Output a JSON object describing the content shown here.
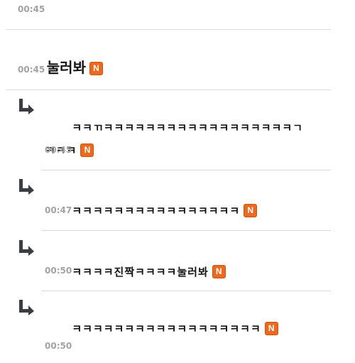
{
  "comments": [
    {
      "type": "time-only",
      "time": "00:45"
    },
    {
      "type": "post",
      "text": "눌러봐",
      "new_badge": "N",
      "time": "00:45"
    },
    {
      "type": "reply",
      "icon": "reply-arrow-icon",
      "text": "ㅋㅋㄲㅋㅋㅋㅋㅋㅋㅋㅋㅋㅋㅋㅋㅋㅋㅋㅋㅋㅋㄱㅋㅋㅋ",
      "new_badge": "N",
      "time": "00:45"
    },
    {
      "type": "reply",
      "icon": "reply-arrow-icon",
      "text": "ㅋㅋㅋㅋㅋㅋㅋㅋㅋㅋㅋㅋㅋㅋㅋㅋ",
      "new_badge": "N",
      "time": "00:47"
    },
    {
      "type": "reply",
      "icon": "reply-arrow-icon",
      "text": "ㅋㅋㅋㅋ진짝ㅋㅋㅋㅋ눌러봐",
      "new_badge": "N",
      "time": "00:50"
    },
    {
      "type": "reply",
      "icon": "reply-arrow-icon",
      "text": "ㅋㅋㅋㅋㅋㅋㅋㅋㅋㅋㅋㅋㅋㅋㅋㅋㅋㅋ",
      "new_badge": "N",
      "time": "00:50"
    }
  ],
  "colors": {
    "badge": "#ec6a1f",
    "timestamp": "#a3a3a3",
    "divider": "#d9d9d9",
    "reply_icon": "#3a3d44"
  }
}
